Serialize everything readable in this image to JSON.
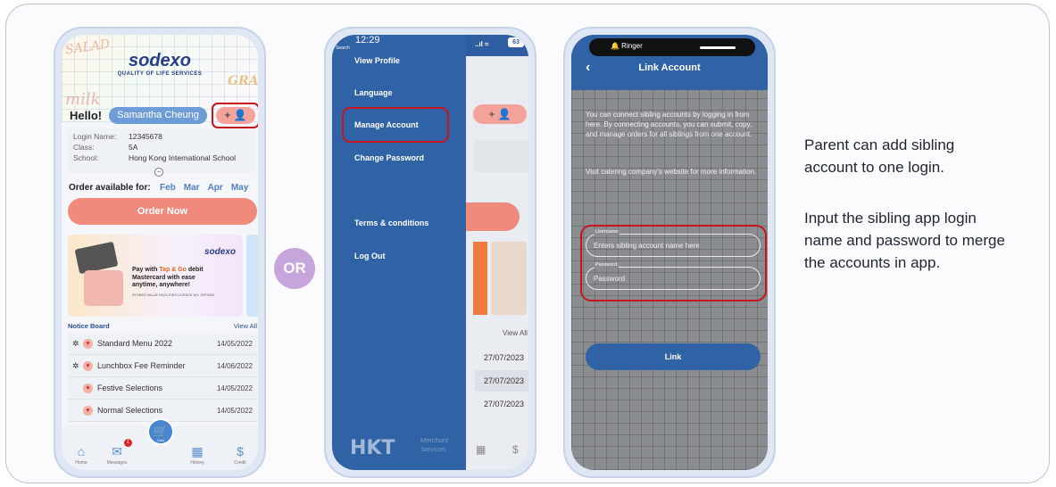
{
  "phone1": {
    "brand": "sodexo",
    "brand_sub": "QUALITY OF LIFE SERVICES",
    "doodles": [
      "SALAD",
      "milk",
      "GRAP"
    ],
    "hello": "Hello!",
    "user_name": "Samantha Cheung",
    "add_label": "+ 👤",
    "info": [
      {
        "k": "Login Name:",
        "v": "12345678"
      },
      {
        "k": "Class:",
        "v": "5A"
      },
      {
        "k": "School:",
        "v": "Hong Kong International School"
      }
    ],
    "collapse_icon": "−",
    "order_available": "Order available for:",
    "months": [
      "Feb",
      "Mar",
      "Apr",
      "May"
    ],
    "order_now": "Order Now",
    "banner": {
      "logo": "sodexo",
      "line1_pre": "Pay with ",
      "line1_hl": "Tap & Go",
      "line1_post": " debit",
      "line2": "Mastercard with ease",
      "line3": "anytime, anywhere!",
      "fine": "STORED VALUE FACILITIES LICENCE NO. SVF0002"
    },
    "notice_board": "Notice Board",
    "view_all": "View All",
    "notices": [
      {
        "pin": "✲",
        "title": "Standard Menu 2022",
        "date": "14/05/2022"
      },
      {
        "pin": "✲",
        "title": "Lunchbox Fee Reminder",
        "date": "14/06/2022"
      },
      {
        "pin": "",
        "title": "Festive Selections",
        "date": "14/05/2022"
      },
      {
        "pin": "",
        "title": "Normal Selections",
        "date": "14/05/2022"
      }
    ],
    "tabs": [
      {
        "icon": "⌂",
        "label": "Home"
      },
      {
        "icon": "✉",
        "label": "Messages"
      },
      {
        "icon": "▦",
        "label": "History"
      },
      {
        "icon": "$",
        "label": "Credit"
      }
    ],
    "cart_icon": "🛒",
    "cart_label": "Cart",
    "badge": "1"
  },
  "or_label": "OR",
  "phone2": {
    "time": "12:29",
    "search": "Search",
    "signal": "..ıl ≈",
    "battery": "63",
    "menu": [
      "View Profile",
      "Language",
      "Manage Account",
      "Change Password",
      "Terms & conditions",
      "Log Out"
    ],
    "hkt": "HKT",
    "hkt_sub": "Merchant Services",
    "behind": {
      "add_label": "+ 👤",
      "view_all": "View All",
      "dates": [
        "27/07/2023",
        "27/07/2023",
        "27/07/2023"
      ],
      "tab_icons": [
        "▦",
        "$"
      ]
    }
  },
  "phone3": {
    "ringer": "🔔 Ringer",
    "back": "‹",
    "title": "Link Account",
    "desc1": "You can connect sibling accounts by logging in from here. By connecting accounts, you can submit, copy, and manage orders for all siblings from one account.",
    "desc2": "Visit catering company's website for more information.",
    "username_label": "Username",
    "username_placeholder": "Enters sibling account name here",
    "password_label": "Password",
    "password_placeholder": "Password",
    "link_button": "Link"
  },
  "side": {
    "line1": "Parent can add sibling",
    "line2": "account to one login.",
    "line3": "Input the sibling app login",
    "line4": "name and password to merge",
    "line5": "the accounts in app."
  },
  "colors": {
    "primary_blue": "#3062a6",
    "order_coral": "#ef8a7d",
    "highlight_red": "#c8141c",
    "or_purple": "#c6a4dc"
  }
}
